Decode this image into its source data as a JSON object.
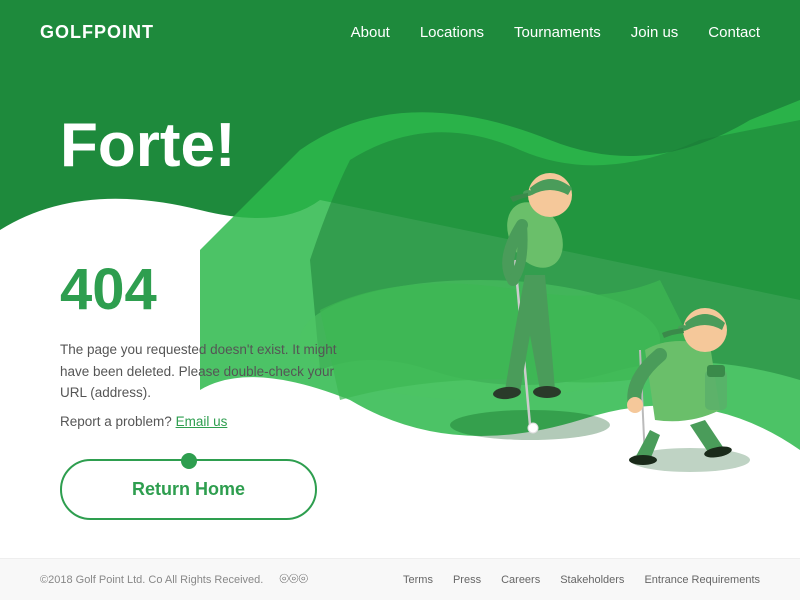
{
  "header": {
    "logo": "GOLFPOINT",
    "nav": {
      "about": "About",
      "locations": "Locations",
      "tournaments": "Tournaments",
      "join_us": "Join us",
      "contact": "Contact"
    }
  },
  "main": {
    "headline": "Forte!",
    "error_code": "404",
    "error_message": "The page you requested doesn't exist. It might have been deleted. Please double-check your URL (address).",
    "report_prefix": "Report a problem?",
    "email_link_label": "Email us",
    "return_home_label": "Return Home"
  },
  "footer": {
    "copyright": "©2018 Golf Point Ltd. Co All Rights Received.",
    "links": {
      "terms": "Terms",
      "press": "Press",
      "careers": "Careers",
      "stakeholders": "Stakeholders",
      "entrance": "Entrance Requirements"
    }
  },
  "colors": {
    "green_dark": "#1a7a35",
    "green_main": "#2db84b",
    "green_medium": "#28a745",
    "green_light": "#5cb85c"
  }
}
